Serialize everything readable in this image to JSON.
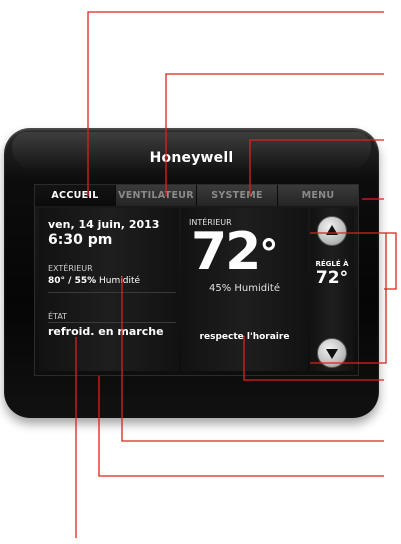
{
  "device": {
    "brand": "Honeywell"
  },
  "tabs": [
    {
      "label": "ACCUEIL",
      "active": true
    },
    {
      "label": "VENTILATEUR",
      "active": false
    },
    {
      "label": "SYSTEME",
      "active": false
    },
    {
      "label": "MENU",
      "active": false
    }
  ],
  "home": {
    "date": "ven, 14 juin, 2013",
    "time": "6:30 pm",
    "outdoor_label": "EXTÉRIEUR",
    "outdoor_value": "80° / 55%",
    "outdoor_humidity_label": "Humidité",
    "state_label": "ÉTAT",
    "state_value": "refroid. en marche"
  },
  "indoor": {
    "label": "INTÉRIEUR",
    "temperature": "72",
    "degree": "°",
    "humidity": "45% Humidité",
    "schedule": "respecte l'horaire"
  },
  "setpoint": {
    "label": "RÉGLÉ À",
    "value": "72°",
    "up_icon": "triangle-up-icon",
    "down_icon": "triangle-down-icon"
  },
  "colors": {
    "callout": "#e0201b",
    "screen_bg": "#141414",
    "bezel": "#0a0a0a"
  }
}
